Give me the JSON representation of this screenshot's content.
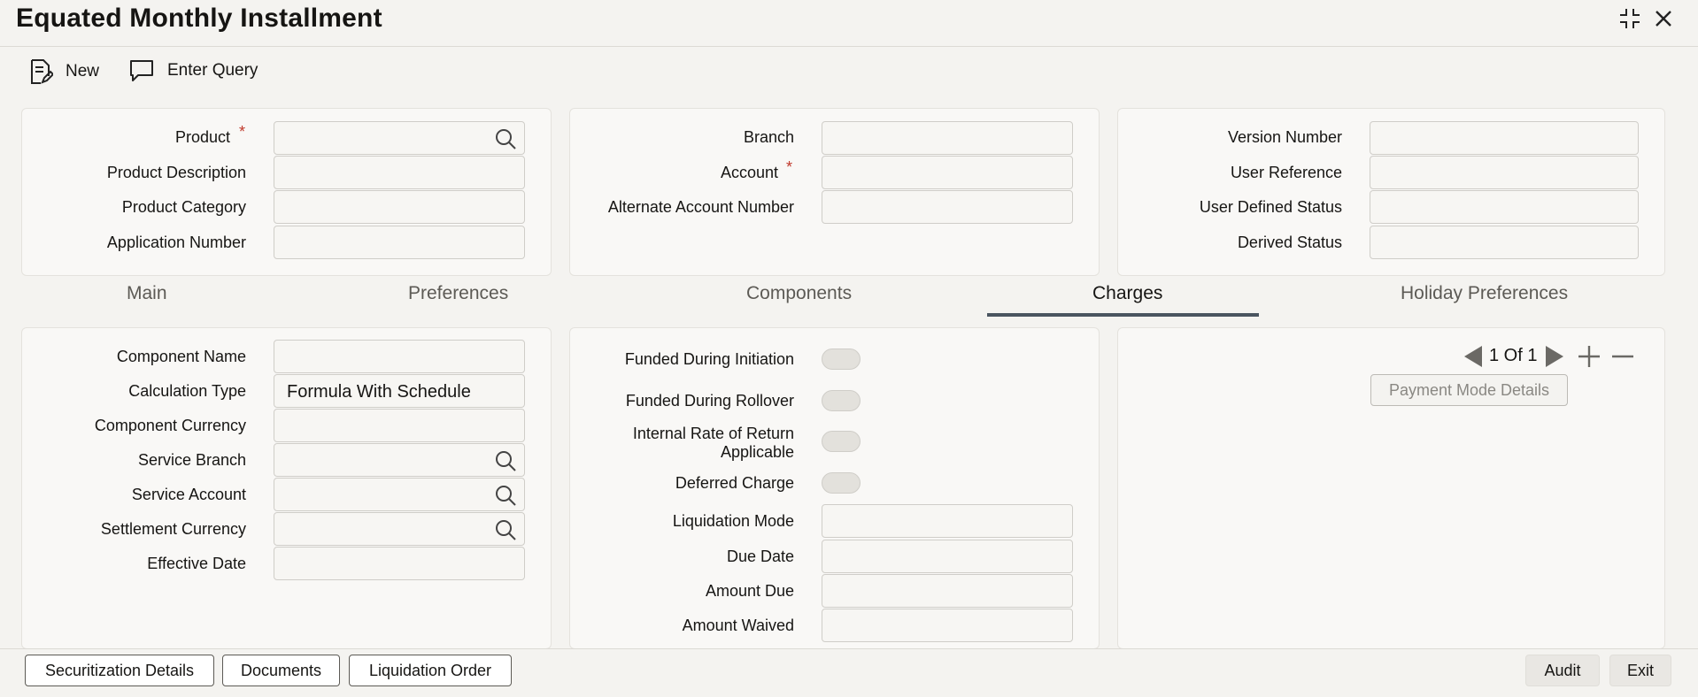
{
  "window": {
    "title": "Equated Monthly Installment",
    "collapse_glyph": "⌟⌞",
    "close_glyph": "✕"
  },
  "toolbar": {
    "new_label": "New",
    "enter_query_label": "Enter Query"
  },
  "header": {
    "left": {
      "product_label": "Product",
      "product_desc_label": "Product Description",
      "product_category_label": "Product Category",
      "application_number_label": "Application Number"
    },
    "mid": {
      "branch_label": "Branch",
      "account_label": "Account",
      "alt_account_label": "Alternate Account Number"
    },
    "right": {
      "version_label": "Version Number",
      "user_ref_label": "User Reference",
      "user_status_label": "User Defined Status",
      "derived_status_label": "Derived Status"
    },
    "required_mark": "*"
  },
  "tabs": [
    {
      "label": "Main"
    },
    {
      "label": "Preferences"
    },
    {
      "label": "Components"
    },
    {
      "label": "Charges"
    },
    {
      "label": "Holiday Preferences"
    }
  ],
  "active_tab": "Charges",
  "charges": {
    "left": {
      "component_name_label": "Component Name",
      "calc_type_label": "Calculation Type",
      "calc_type_value": "Formula With Schedule",
      "component_currency_label": "Component Currency",
      "service_branch_label": "Service Branch",
      "service_account_label": "Service Account",
      "settlement_currency_label": "Settlement Currency",
      "effective_date_label": "Effective Date"
    },
    "mid": {
      "funded_initiation_label": "Funded During Initiation",
      "funded_rollover_label": "Funded During Rollover",
      "irr_label_line1": "Internal Rate of Return",
      "irr_label_line2": "Applicable",
      "deferred_label": "Deferred Charge",
      "liquidation_mode_label": "Liquidation Mode",
      "due_date_label": "Due Date",
      "amount_due_label": "Amount Due",
      "amount_waived_label": "Amount Waived"
    },
    "right": {
      "pagination_text": "1 Of 1",
      "payment_mode_label": "Payment Mode Details"
    }
  },
  "footer": {
    "securitization_label": "Securitization Details",
    "documents_label": "Documents",
    "liquidation_order_label": "Liquidation Order",
    "audit_label": "Audit",
    "exit_label": "Exit"
  }
}
